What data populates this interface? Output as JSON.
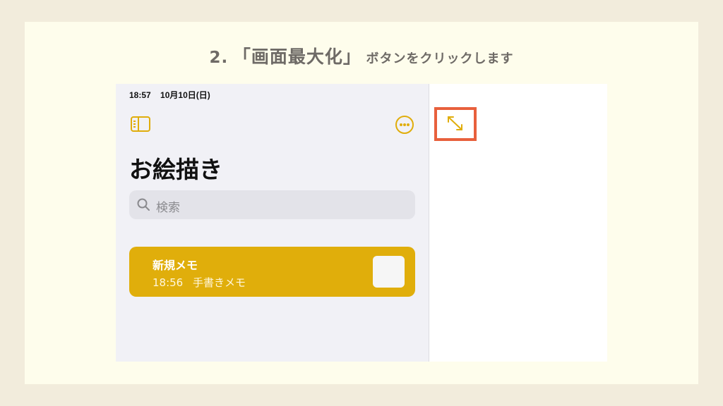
{
  "instruction": {
    "step": "2.",
    "main": "「画面最大化」",
    "rest": "ボタンをクリックします"
  },
  "status_bar": {
    "time": "18:57",
    "date": "10月10日(日)"
  },
  "folder_title": "お絵描き",
  "search": {
    "placeholder": "検索"
  },
  "notes": [
    {
      "title": "新規メモ",
      "time": "18:56",
      "subtitle": "手書きメモ"
    }
  ],
  "colors": {
    "accent": "#e0ad0b",
    "highlight": "#e8603c",
    "background": "#f2ecdc"
  },
  "icons": [
    "sidebar-toggle-icon",
    "more-icon",
    "search-icon",
    "expand-icon"
  ]
}
